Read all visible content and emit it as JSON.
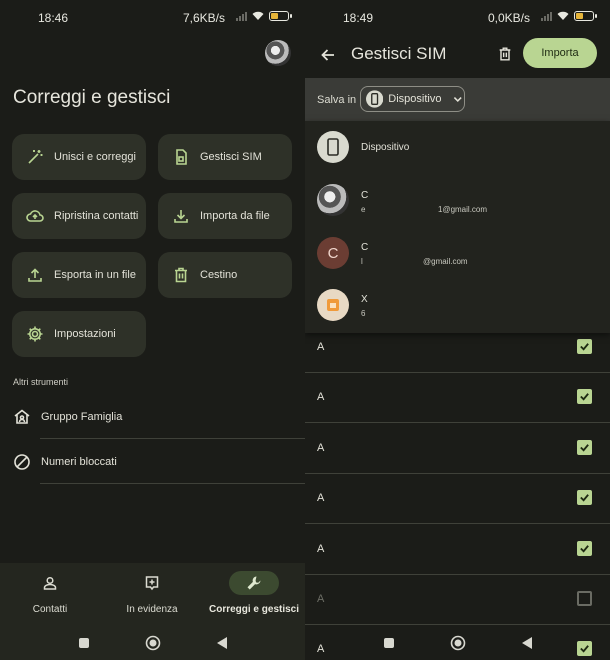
{
  "left": {
    "status": {
      "time": "18:46",
      "netspeed": "7,6KB/s"
    },
    "title": "Correggi e gestisci",
    "actions": [
      {
        "label": "Unisci e correggi",
        "icon": "magic-wand-icon"
      },
      {
        "label": "Gestisci SIM",
        "icon": "sim-card-icon"
      },
      {
        "label": "Ripristina contatti",
        "icon": "cloud-restore-icon"
      },
      {
        "label": "Importa da file",
        "icon": "download-icon"
      },
      {
        "label": "Esporta in un file",
        "icon": "upload-icon"
      },
      {
        "label": "Cestino",
        "icon": "trash-icon"
      },
      {
        "label": "Impostazioni",
        "icon": "gear-icon"
      }
    ],
    "tools_header": "Altri strumenti",
    "tools": [
      {
        "label": "Gruppo Famiglia",
        "icon": "family-home-icon"
      },
      {
        "label": "Numeri bloccati",
        "icon": "blocked-icon"
      }
    ],
    "nav": [
      {
        "label": "Contatti",
        "icon": "person-icon"
      },
      {
        "label": "In evidenza",
        "icon": "highlight-icon"
      },
      {
        "label": "Correggi e gestisci",
        "icon": "wrench-icon"
      }
    ]
  },
  "right": {
    "status": {
      "time": "18:49",
      "netspeed": "0,0KB/s"
    },
    "title": "Gestisci SIM",
    "import_label": "Importa",
    "save_in_label": "Salva in",
    "selected_target": "Dispositivo",
    "dropdown": [
      {
        "title": "Dispositivo",
        "sub": "",
        "sub2": "",
        "avatar": "device"
      },
      {
        "title": "C",
        "sub": "e",
        "sub2": "1@gmail.com",
        "avatar": "photo"
      },
      {
        "title": "C",
        "sub": "l",
        "sub2": "@gmail.com",
        "avatar": "letter",
        "letter": "C"
      },
      {
        "title": "X",
        "sub": "6",
        "sub2": "",
        "avatar": "sim"
      }
    ],
    "contacts": [
      {
        "name": "A",
        "checked": true
      },
      {
        "name": "A",
        "checked": true
      },
      {
        "name": "A",
        "checked": true
      },
      {
        "name": "A",
        "checked": true
      },
      {
        "name": "A",
        "checked": true
      },
      {
        "name": "A",
        "checked": false
      },
      {
        "name": "A",
        "checked": true
      }
    ]
  },
  "colors": {
    "accent": "#b9d592",
    "background": "#1b1c18",
    "card": "#2e3128"
  }
}
